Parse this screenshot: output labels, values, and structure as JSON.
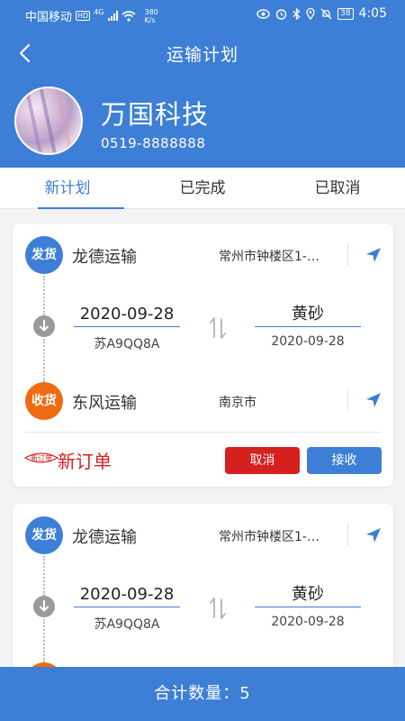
{
  "status_bar": {
    "carrier": "中国移动",
    "hd": "HD",
    "signal_type": "4G",
    "speed_value": "380",
    "speed_unit": "K/s",
    "battery": "38",
    "time": "4:05"
  },
  "header": {
    "title": "运输计划",
    "company_name": "万国科技",
    "phone": "0519-8888888"
  },
  "tabs": [
    {
      "label": "新计划",
      "active": true
    },
    {
      "label": "已完成",
      "active": false
    },
    {
      "label": "已取消",
      "active": false
    }
  ],
  "plans": [
    {
      "send_badge": "发货",
      "sender": "龙德运输",
      "sender_address": "常州市钟楼区1-…",
      "date": "2020-09-28",
      "plate": "苏A9QQ8A",
      "cargo": "黄砂",
      "cargo_date": "2020-09-28",
      "recv_badge": "收货",
      "receiver": "东风运输",
      "receiver_address": "南京市",
      "order_logo": "新订单",
      "status": "新订单",
      "cancel_label": "取消",
      "accept_label": "接收"
    },
    {
      "send_badge": "发货",
      "sender": "龙德运输",
      "sender_address": "常州市钟楼区1-…",
      "date": "2020-09-28",
      "plate": "苏A9QQ8A",
      "cargo": "黄砂",
      "cargo_date": "2020-09-28"
    }
  ],
  "footer": {
    "total_label": "合计数量：",
    "total_count": "5"
  },
  "colors": {
    "primary": "#3d7fd6",
    "receive": "#f06a14",
    "danger": "#d6201e"
  },
  "icons": [
    "back-arrow-icon",
    "navigation-arrow-icon",
    "down-arrow-icon",
    "swap-icon",
    "wifi-icon",
    "eye-icon",
    "alarm-icon",
    "bluetooth-icon",
    "location-icon",
    "mute-icon"
  ]
}
